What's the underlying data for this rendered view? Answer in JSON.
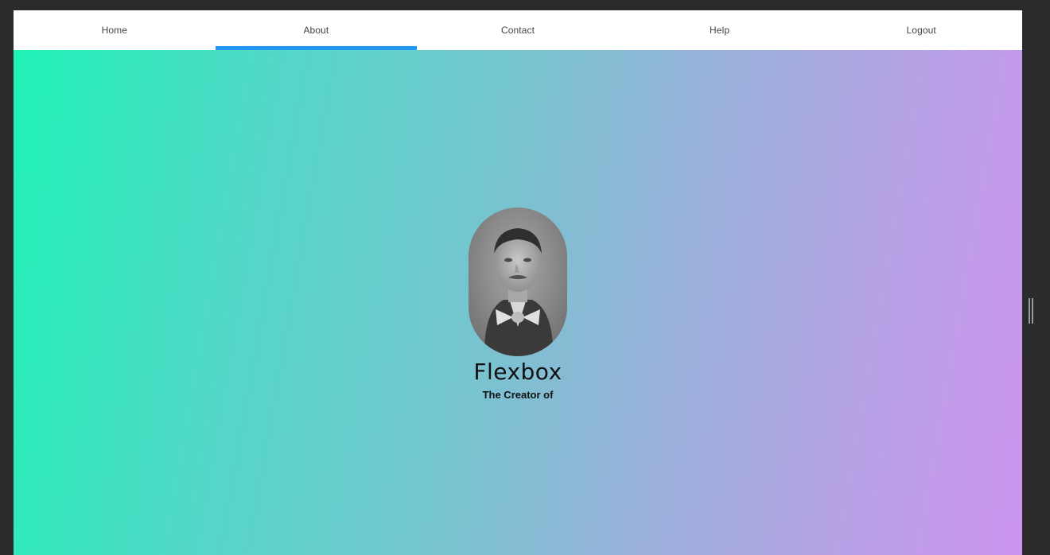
{
  "nav": {
    "items": [
      {
        "label": "Home"
      },
      {
        "label": "About",
        "active": true
      },
      {
        "label": "Contact"
      },
      {
        "label": "Help"
      },
      {
        "label": "Logout"
      }
    ],
    "active_indicator_color": "#2196f3"
  },
  "hero": {
    "title": "Flexbox",
    "subtitle": "The Creator of",
    "gradient_start": "#1ff2b6",
    "gradient_end": "#cc94ee"
  },
  "icons": {
    "portrait": "portrait-photo",
    "resize_handle": "resize-handle-icon"
  }
}
